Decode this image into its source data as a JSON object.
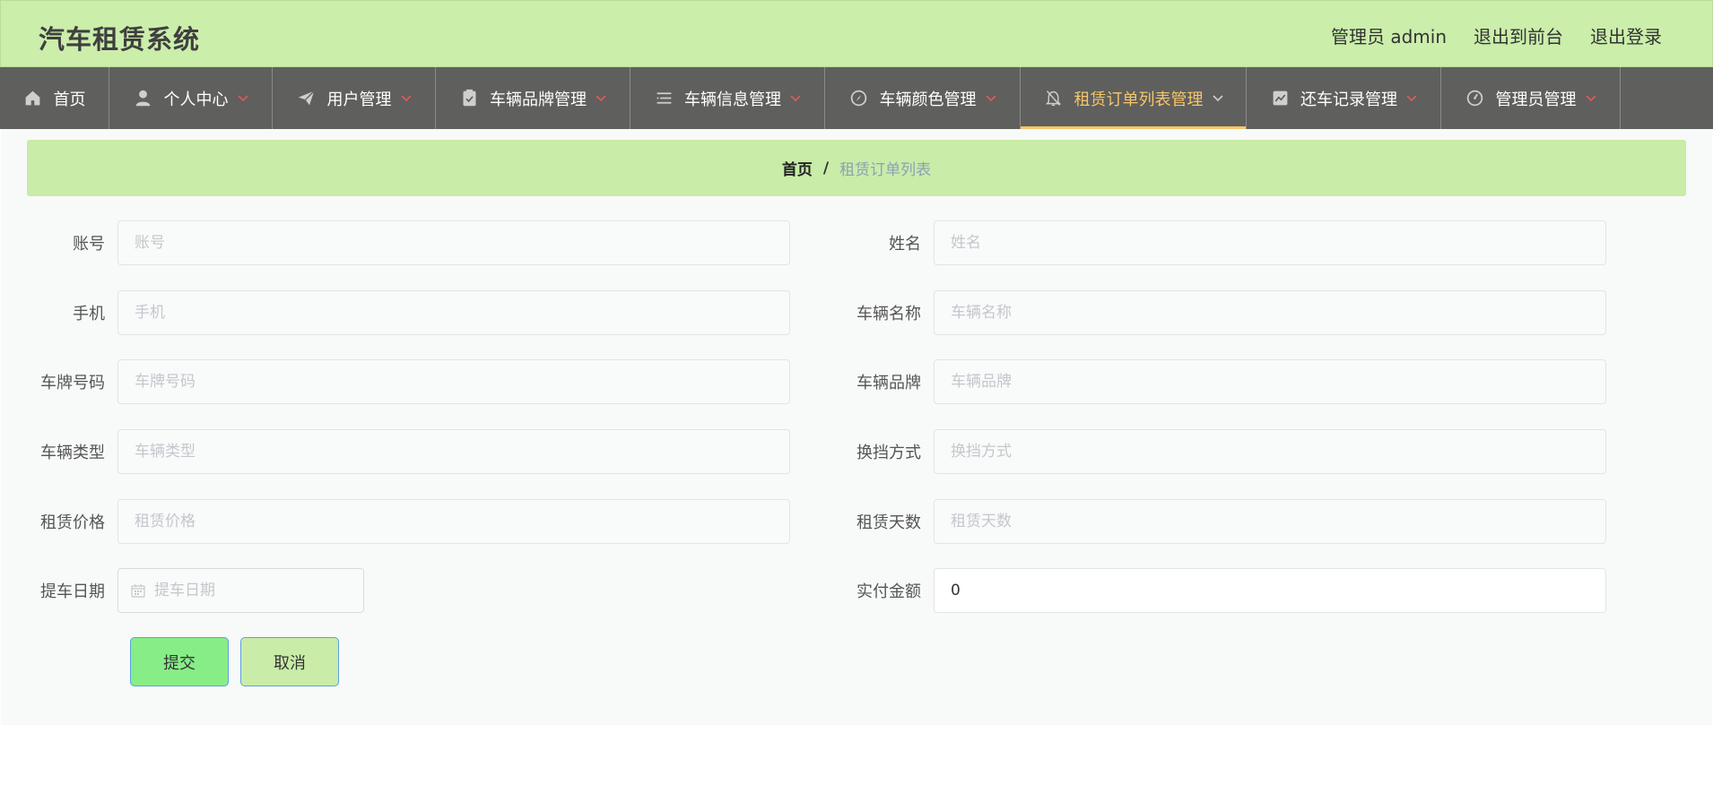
{
  "header": {
    "app_title": "汽车租赁系统",
    "admin_label": "管理员 admin",
    "back_to_front": "退出到前台",
    "logout": "退出登录"
  },
  "nav": {
    "items": [
      {
        "label": "首页",
        "icon": "home-icon"
      },
      {
        "label": "个人中心",
        "icon": "user-icon"
      },
      {
        "label": "用户管理",
        "icon": "paper-plane-icon"
      },
      {
        "label": "车辆品牌管理",
        "icon": "clipboard-check-icon"
      },
      {
        "label": "车辆信息管理",
        "icon": "list-icon"
      },
      {
        "label": "车辆颜色管理",
        "icon": "compass-icon"
      },
      {
        "label": "租赁订单列表管理",
        "icon": "bell-off-icon"
      },
      {
        "label": "还车记录管理",
        "icon": "chart-icon"
      },
      {
        "label": "管理员管理",
        "icon": "dashboard-icon"
      }
    ],
    "active_index": 6,
    "active_color": "#f5c66a"
  },
  "breadcrumb": {
    "home": "首页",
    "separator": "/",
    "current": "租赁订单列表"
  },
  "form": {
    "account": {
      "label": "账号",
      "placeholder": "账号",
      "value": ""
    },
    "name": {
      "label": "姓名",
      "placeholder": "姓名",
      "value": ""
    },
    "phone": {
      "label": "手机",
      "placeholder": "手机",
      "value": ""
    },
    "car_name": {
      "label": "车辆名称",
      "placeholder": "车辆名称",
      "value": ""
    },
    "plate": {
      "label": "车牌号码",
      "placeholder": "车牌号码",
      "value": ""
    },
    "brand": {
      "label": "车辆品牌",
      "placeholder": "车辆品牌",
      "value": ""
    },
    "car_type": {
      "label": "车辆类型",
      "placeholder": "车辆类型",
      "value": ""
    },
    "gear": {
      "label": "换挡方式",
      "placeholder": "换挡方式",
      "value": ""
    },
    "price": {
      "label": "租赁价格",
      "placeholder": "租赁价格",
      "value": ""
    },
    "days": {
      "label": "租赁天数",
      "placeholder": "租赁天数",
      "value": ""
    },
    "pickup_date": {
      "label": "提车日期",
      "placeholder": "提车日期",
      "value": ""
    },
    "paid": {
      "label": "实付金额",
      "placeholder": "",
      "value": "0"
    }
  },
  "buttons": {
    "submit": "提交",
    "cancel": "取消"
  }
}
